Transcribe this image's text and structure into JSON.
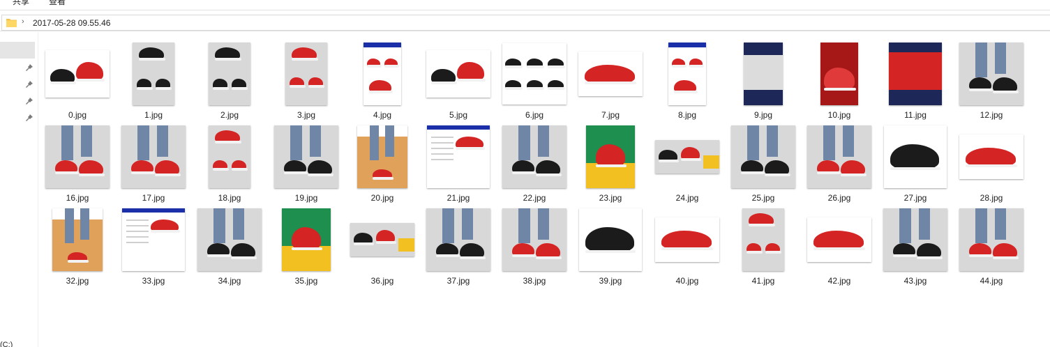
{
  "ribbon": {
    "tabs": [
      "共享",
      "查看"
    ]
  },
  "address": {
    "path": "2017-05-28 09.55.46"
  },
  "nav": {
    "drive_label": "(C:)"
  },
  "colors": {
    "accent_red": "#d42424",
    "shoe_black": "#1b1b1b",
    "selection": "#e5e5e5"
  },
  "files": [
    {
      "name": "0.jpg",
      "kind": "red-black"
    },
    {
      "name": "1.jpg",
      "kind": "collage-black"
    },
    {
      "name": "2.jpg",
      "kind": "collage-black"
    },
    {
      "name": "3.jpg",
      "kind": "collage-red"
    },
    {
      "name": "4.jpg",
      "kind": "banner-red"
    },
    {
      "name": "5.jpg",
      "kind": "red-black"
    },
    {
      "name": "6.jpg",
      "kind": "colors-black"
    },
    {
      "name": "7.jpg",
      "kind": "red"
    },
    {
      "name": "8.jpg",
      "kind": "banner-red"
    },
    {
      "name": "9.jpg",
      "kind": "navy-sole"
    },
    {
      "name": "10.jpg",
      "kind": "red-detail"
    },
    {
      "name": "11.jpg",
      "kind": "navy-red"
    },
    {
      "name": "12.jpg",
      "kind": "legs-black"
    },
    {
      "name": "16.jpg",
      "kind": "legs-red"
    },
    {
      "name": "17.jpg",
      "kind": "legs-red"
    },
    {
      "name": "18.jpg",
      "kind": "collage-red"
    },
    {
      "name": "19.jpg",
      "kind": "legs-black"
    },
    {
      "name": "20.jpg",
      "kind": "orange-poster"
    },
    {
      "name": "21.jpg",
      "kind": "spec-sheet"
    },
    {
      "name": "22.jpg",
      "kind": "legs-black"
    },
    {
      "name": "23.jpg",
      "kind": "green-poster"
    },
    {
      "name": "24.jpg",
      "kind": "wide-pair"
    },
    {
      "name": "25.jpg",
      "kind": "legs-black"
    },
    {
      "name": "26.jpg",
      "kind": "legs-red"
    },
    {
      "name": "27.jpg",
      "kind": "black"
    },
    {
      "name": "28.jpg",
      "kind": "red"
    },
    {
      "name": "32.jpg",
      "kind": "orange-poster"
    },
    {
      "name": "33.jpg",
      "kind": "spec-sheet"
    },
    {
      "name": "34.jpg",
      "kind": "legs-black"
    },
    {
      "name": "35.jpg",
      "kind": "green-poster"
    },
    {
      "name": "36.jpg",
      "kind": "wide-pair"
    },
    {
      "name": "37.jpg",
      "kind": "legs-black"
    },
    {
      "name": "38.jpg",
      "kind": "legs-red"
    },
    {
      "name": "39.jpg",
      "kind": "black"
    },
    {
      "name": "40.jpg",
      "kind": "red"
    },
    {
      "name": "41.jpg",
      "kind": "collage-red"
    },
    {
      "name": "42.jpg",
      "kind": "red"
    },
    {
      "name": "43.jpg",
      "kind": "legs-black"
    },
    {
      "name": "44.jpg",
      "kind": "legs-red"
    }
  ]
}
